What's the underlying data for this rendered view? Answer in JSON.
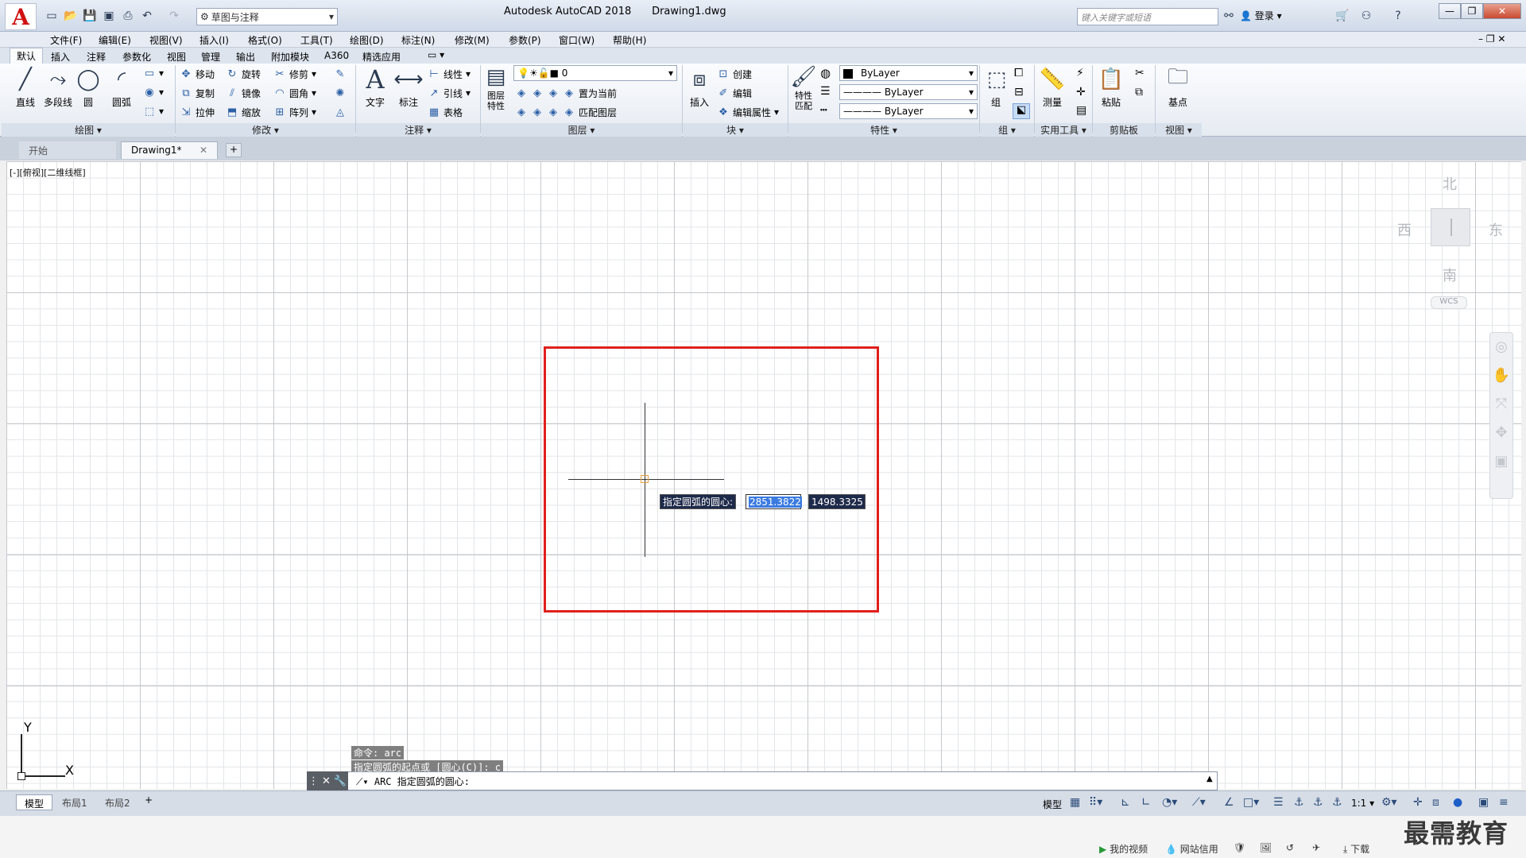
{
  "titlebar": {
    "workspace": "草图与注释",
    "title": "Autodesk AutoCAD 2018",
    "filename": "Drawing1.dwg",
    "search_placeholder": "键入关键字或短语",
    "login": "登录"
  },
  "menu": [
    "文件(F)",
    "编辑(E)",
    "视图(V)",
    "插入(I)",
    "格式(O)",
    "工具(T)",
    "绘图(D)",
    "标注(N)",
    "修改(M)",
    "参数(P)",
    "窗口(W)",
    "帮助(H)"
  ],
  "ribbon_tabs": [
    "默认",
    "插入",
    "注释",
    "参数化",
    "视图",
    "管理",
    "输出",
    "附加模块",
    "A360",
    "精选应用"
  ],
  "draw_panel": {
    "line": "直线",
    "polyline": "多段线",
    "circle": "圆",
    "arc": "圆弧",
    "title": "绘图"
  },
  "modify_panel": {
    "move": "移动",
    "rotate": "旋转",
    "trim": "修剪",
    "copy": "复制",
    "mirror": "镜像",
    "fillet": "圆角",
    "stretch": "拉伸",
    "scale": "缩放",
    "array": "阵列",
    "title": "修改"
  },
  "annotation_panel": {
    "text": "文字",
    "dimension": "标注",
    "linear": "线性",
    "leader": "引线",
    "table": "表格",
    "title": "注释"
  },
  "layers_panel": {
    "layer_props_1": "图层",
    "layer_props_2": "特性",
    "current_layer": "0",
    "set_current": "置为当前",
    "match_layer": "匹配图层",
    "title": "图层"
  },
  "block_panel": {
    "insert": "插入",
    "create": "创建",
    "edit": "编辑",
    "edit_attr": "编辑属性",
    "title": "块"
  },
  "properties_panel": {
    "match_1": "特性",
    "match_2": "匹配",
    "color": "ByLayer",
    "linetype": "ByLayer",
    "lineweight": "ByLayer",
    "title": "特性"
  },
  "groups_panel": {
    "group": "组",
    "title": "组"
  },
  "utilities_panel": {
    "measure": "测量",
    "title": "实用工具"
  },
  "clipboard_panel": {
    "paste": "粘贴",
    "title": "剪贴板"
  },
  "view_panel": {
    "base": "基点",
    "title": "视图"
  },
  "file_tabs": {
    "start": "开始",
    "drawing": "Drawing1*"
  },
  "viewport_label": "[-][俯视][二维线框]",
  "viewcube": {
    "north": "北",
    "south": "南",
    "east": "东",
    "west": "西",
    "wcs": "WCS"
  },
  "dynamic_input": {
    "prompt": "指定圆弧的圆心:",
    "x": "2851.3822",
    "y": "1498.3325"
  },
  "ucs": {
    "x": "X",
    "y": "Y"
  },
  "command_history": [
    "命令: arc",
    "指定圆弧的起点或 [圆心(C)]: c"
  ],
  "command_line": "ARC 指定圆弧的圆心:",
  "layout_tabs": [
    "模型",
    "布局1",
    "布局2"
  ],
  "status": {
    "model": "模型",
    "scale": "1:1"
  },
  "taskbar": {
    "video": "我的视频",
    "credit": "网站信用",
    "download": "下载"
  },
  "watermark": "最需教育"
}
